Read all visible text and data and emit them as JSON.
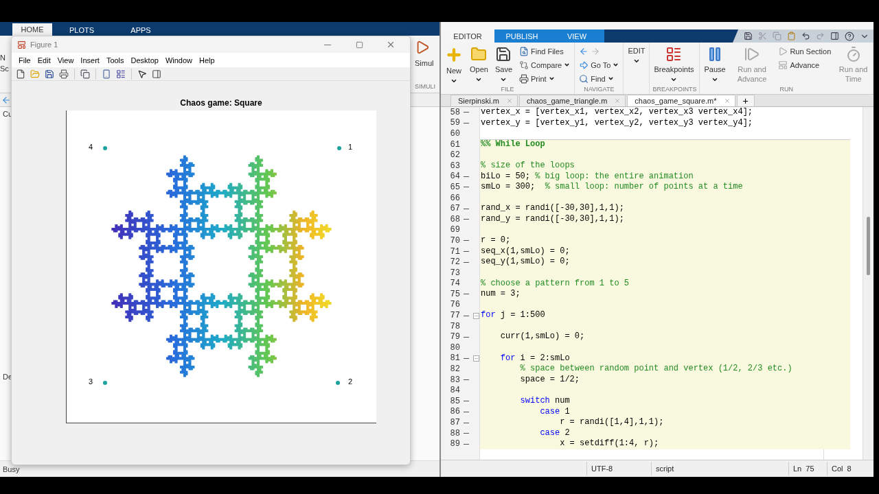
{
  "desktop": {
    "tabs": [
      {
        "label": "HOME",
        "selected": true
      },
      {
        "label": "PLOTS",
        "selected": false
      },
      {
        "label": "APPS",
        "selected": false
      }
    ],
    "ribbon_left": [
      "N",
      "Sc"
    ],
    "simulink_button": "Simul",
    "simulink_section": "SIMULI",
    "panel_labels": [
      "Cu",
      "De"
    ],
    "status": "Busy"
  },
  "figure": {
    "title": "Figure 1",
    "menu": [
      "File",
      "Edit",
      "View",
      "Insert",
      "Tools",
      "Desktop",
      "Window",
      "Help"
    ],
    "plot": {
      "title": "Chaos game: Square",
      "vertices": [
        {
          "label": "4"
        },
        {
          "label": "1"
        },
        {
          "label": "3"
        },
        {
          "label": "2"
        }
      ]
    }
  },
  "editor": {
    "tabs": [
      {
        "label": "EDITOR",
        "selected": true
      },
      {
        "label": "PUBLISH",
        "selected": false
      },
      {
        "label": "VIEW",
        "selected": false
      }
    ],
    "sections": [
      {
        "label": "FILE",
        "buttons": [
          {
            "kind": "large",
            "label": "New",
            "dropdown": true,
            "disabled": false
          },
          {
            "kind": "large",
            "label": "Open",
            "dropdown": true,
            "disabled": false
          },
          {
            "kind": "large",
            "label": "Save",
            "dropdown": true,
            "disabled": false
          },
          {
            "kind": "stack",
            "items": [
              {
                "label": "Find Files",
                "dropdown": false
              },
              {
                "label": "Compare",
                "dropdown": true
              },
              {
                "label": "Print",
                "dropdown": true
              }
            ]
          }
        ]
      },
      {
        "label": "NAVIGATE",
        "buttons": [
          {
            "kind": "stack",
            "items": [
              {
                "dropdown": false
              },
              {
                "label": "Go To",
                "dropdown": true
              },
              {
                "label": "Find",
                "dropdown": true
              }
            ]
          }
        ]
      },
      {
        "buttons": [
          {
            "kind": "large",
            "label": "EDIT",
            "dropdown": true,
            "disabled": false
          }
        ]
      },
      {
        "label": "BREAKPOINTS",
        "buttons": [
          {
            "kind": "large",
            "label": "Breakpoints",
            "dropdown": true,
            "disabled": false
          }
        ]
      },
      {
        "label": "RUN",
        "buttons": [
          {
            "kind": "large",
            "label": "Pause",
            "dropdown": true,
            "disabled": false
          },
          {
            "kind": "large",
            "label": "Run and Advance",
            "dropdown": false,
            "disabled": true
          },
          {
            "kind": "stack",
            "items": [
              {
                "label": "Run Section",
                "dropdown": false
              },
              {
                "label": "Advance",
                "dropdown": false
              }
            ]
          },
          {
            "kind": "large",
            "label": "Run and Time",
            "dropdown": false,
            "disabled": true
          }
        ]
      }
    ],
    "file_tabs": [
      {
        "label": "Sierpinski.m",
        "selected": false
      },
      {
        "label": "chaos_game_triangle.m",
        "selected": false
      },
      {
        "label": "chaos_game_square.m*",
        "selected": true
      }
    ],
    "new_tab": "+",
    "lines": [
      {
        "number": "58",
        "executable": true,
        "fold": false,
        "highlighted": false,
        "parts": [
          {
            "kind": "plain",
            "text": "vertex_x = [vertex_x1, vertex_x2, vertex_x3 vertex_x4];"
          }
        ]
      },
      {
        "number": "59",
        "executable": true,
        "fold": false,
        "highlighted": false,
        "parts": [
          {
            "kind": "plain",
            "text": "vertex_y = [vertex_y1, vertex_y2, vertex_y3 vertex_y4];"
          }
        ]
      },
      {
        "number": "60",
        "executable": false,
        "fold": false,
        "highlighted": false
      },
      {
        "number": "61",
        "executable": false,
        "fold": false,
        "highlighted": true,
        "parts": [
          {
            "kind": "section",
            "text": "%% While Loop"
          }
        ]
      },
      {
        "number": "62",
        "executable": false,
        "fold": false,
        "highlighted": true
      },
      {
        "number": "63",
        "executable": false,
        "fold": false,
        "highlighted": true,
        "parts": [
          {
            "kind": "comment",
            "text": "% size of the loops"
          }
        ]
      },
      {
        "number": "64",
        "executable": true,
        "fold": false,
        "highlighted": true,
        "parts": [
          {
            "kind": "plain",
            "text": "biLo = 50; "
          },
          {
            "kind": "comment",
            "text": "% big loop: the entire animation"
          }
        ]
      },
      {
        "number": "65",
        "executable": true,
        "fold": false,
        "highlighted": true,
        "parts": [
          {
            "kind": "plain",
            "text": "smLo = 300;  "
          },
          {
            "kind": "comment",
            "text": "% small loop: number of points at a time"
          }
        ]
      },
      {
        "number": "66",
        "executable": false,
        "fold": false,
        "highlighted": true
      },
      {
        "number": "67",
        "executable": true,
        "fold": false,
        "highlighted": true,
        "parts": [
          {
            "kind": "plain",
            "text": "rand_x = randi([-30,30],1,1);"
          }
        ]
      },
      {
        "number": "68",
        "executable": true,
        "fold": false,
        "highlighted": true,
        "parts": [
          {
            "kind": "plain",
            "text": "rand_y = randi([-30,30],1,1);"
          }
        ]
      },
      {
        "number": "69",
        "executable": false,
        "fold": false,
        "highlighted": true
      },
      {
        "number": "70",
        "executable": true,
        "fold": false,
        "highlighted": true,
        "parts": [
          {
            "kind": "plain",
            "text": "r = 0;"
          }
        ]
      },
      {
        "number": "71",
        "executable": true,
        "fold": false,
        "highlighted": true,
        "parts": [
          {
            "kind": "plain",
            "text": "seq_x(1,smLo) = 0;"
          }
        ]
      },
      {
        "number": "72",
        "executable": true,
        "fold": false,
        "highlighted": true,
        "parts": [
          {
            "kind": "plain",
            "text": "seq_y(1,smLo) = 0;"
          }
        ]
      },
      {
        "number": "73",
        "executable": false,
        "fold": false,
        "highlighted": true
      },
      {
        "number": "74",
        "executable": false,
        "fold": false,
        "highlighted": true,
        "parts": [
          {
            "kind": "comment",
            "text": "% choose a pattern from 1 to 5"
          }
        ]
      },
      {
        "number": "75",
        "executable": true,
        "fold": false,
        "highlighted": true,
        "parts": [
          {
            "kind": "plain",
            "text": "num = 3;"
          }
        ]
      },
      {
        "number": "76",
        "executable": false,
        "fold": false,
        "highlighted": true
      },
      {
        "number": "77",
        "executable": true,
        "fold": true,
        "highlighted": true,
        "parts": [
          {
            "kind": "keyword",
            "text": "for"
          },
          {
            "kind": "plain",
            "text": " j = 1:500"
          }
        ]
      },
      {
        "number": "78",
        "executable": false,
        "fold": false,
        "highlighted": true
      },
      {
        "number": "79",
        "executable": true,
        "fold": false,
        "highlighted": true,
        "parts": [
          {
            "kind": "plain",
            "text": "    curr(1,smLo) = 0;"
          }
        ]
      },
      {
        "number": "80",
        "executable": false,
        "fold": false,
        "highlighted": true
      },
      {
        "number": "81",
        "executable": true,
        "fold": true,
        "highlighted": true,
        "parts": [
          {
            "kind": "keyword",
            "text": "    for"
          },
          {
            "kind": "plain",
            "text": " i = 2:smLo"
          }
        ]
      },
      {
        "number": "82",
        "executable": false,
        "fold": false,
        "highlighted": true,
        "parts": [
          {
            "kind": "comment",
            "text": "        % space between random point and vertex (1/2, 2/3 etc.)"
          }
        ]
      },
      {
        "number": "83",
        "executable": true,
        "fold": false,
        "highlighted": true,
        "parts": [
          {
            "kind": "plain",
            "text": "        space = 1/2;"
          }
        ]
      },
      {
        "number": "84",
        "executable": false,
        "fold": false,
        "highlighted": true
      },
      {
        "number": "85",
        "executable": true,
        "fold": false,
        "highlighted": true,
        "parts": [
          {
            "kind": "keyword",
            "text": "        switch"
          },
          {
            "kind": "plain",
            "text": " num"
          }
        ]
      },
      {
        "number": "86",
        "executable": true,
        "fold": false,
        "highlighted": true,
        "parts": [
          {
            "kind": "keyword",
            "text": "            case"
          },
          {
            "kind": "plain",
            "text": " 1"
          }
        ]
      },
      {
        "number": "87",
        "executable": true,
        "fold": false,
        "highlighted": true,
        "parts": [
          {
            "kind": "plain",
            "text": "                r = randi([1,4],1,1);"
          }
        ]
      },
      {
        "number": "88",
        "executable": true,
        "fold": false,
        "highlighted": true,
        "parts": [
          {
            "kind": "keyword",
            "text": "            case"
          },
          {
            "kind": "plain",
            "text": " 2"
          }
        ]
      },
      {
        "number": "89",
        "executable": true,
        "fold": false,
        "highlighted": true,
        "parts": [
          {
            "kind": "plain",
            "text": "                x = setdiff(1:4, r);"
          }
        ]
      }
    ],
    "status": {
      "encoding": "UTF-8",
      "file_type": "script",
      "line": "Ln  75",
      "column": "Col  8"
    }
  }
}
